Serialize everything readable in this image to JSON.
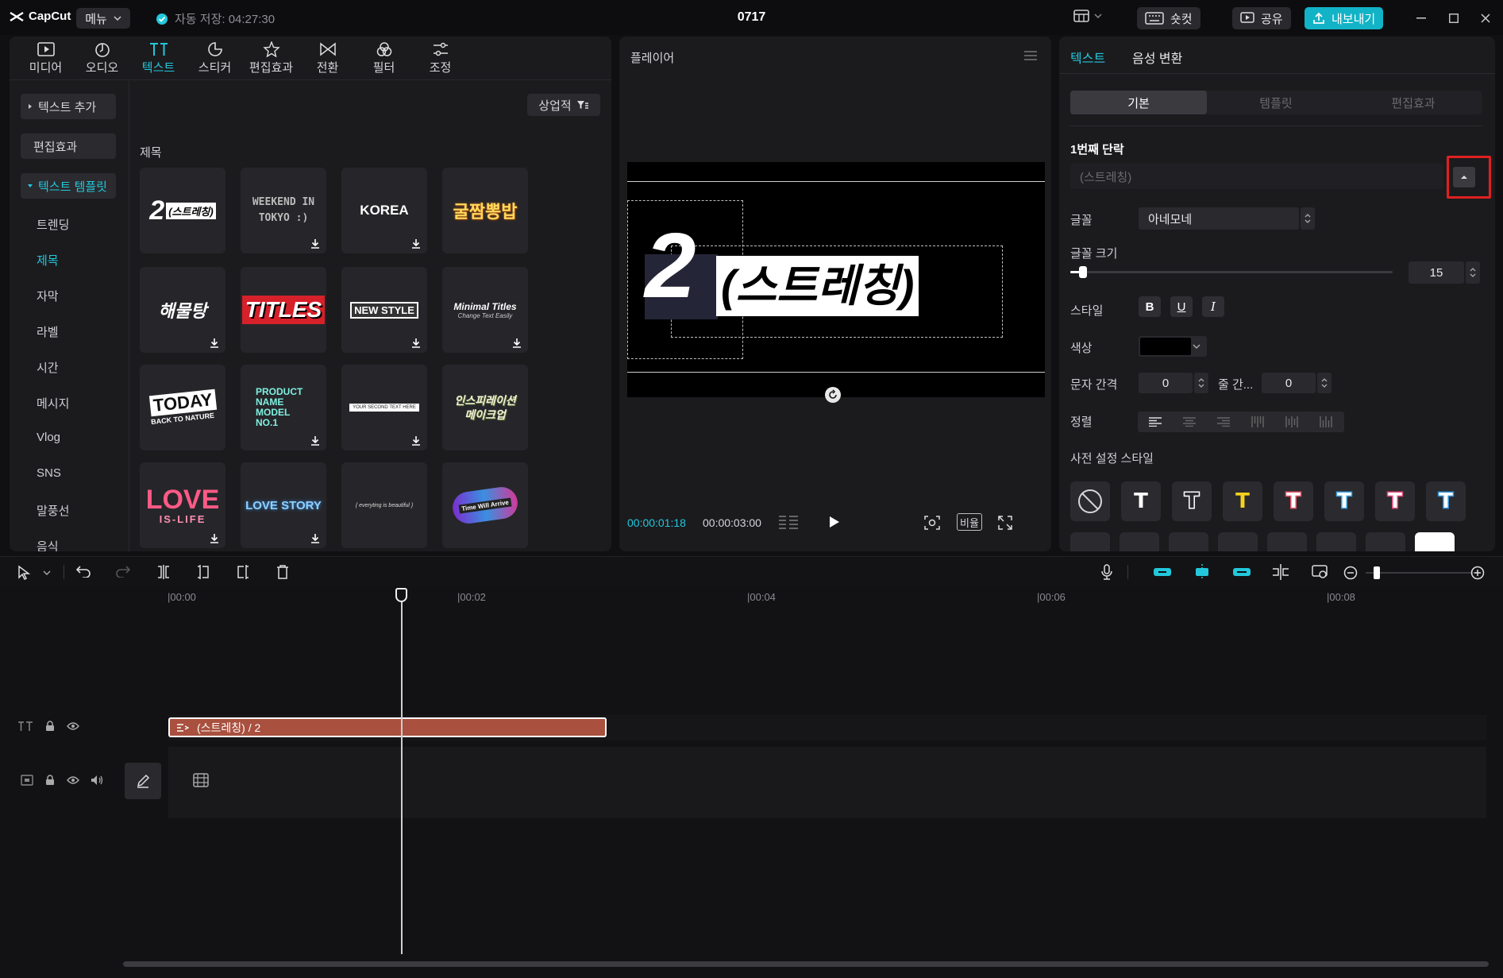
{
  "app": {
    "logo_text": "CapCut",
    "menu_label": "메뉴",
    "autosave": "자동 저장: 04:27:30",
    "project_title": "0717"
  },
  "titlebar_buttons": {
    "shortcut": "숏컷",
    "share": "공유",
    "export": "내보내기"
  },
  "tool_tabs": [
    {
      "label": "미디어",
      "icon": "media-icon",
      "active": false
    },
    {
      "label": "오디오",
      "icon": "audio-icon",
      "active": false
    },
    {
      "label": "텍스트",
      "icon": "text-icon",
      "active": true
    },
    {
      "label": "스티커",
      "icon": "sticker-icon",
      "active": false
    },
    {
      "label": "편집효과",
      "icon": "effects-icon",
      "active": false
    },
    {
      "label": "전환",
      "icon": "transition-icon",
      "active": false
    },
    {
      "label": "필터",
      "icon": "filter-icon",
      "active": false
    },
    {
      "label": "조정",
      "icon": "adjust-icon",
      "active": false
    }
  ],
  "left_nav": {
    "add_text": "텍스트 추가",
    "effects": "편집효과",
    "templates": "텍스트 템플릿",
    "items": [
      "트렌딩",
      "제목",
      "자막",
      "라벨",
      "시간",
      "메시지",
      "Vlog",
      "SNS",
      "말풍선",
      "음식"
    ],
    "active_item": "제목"
  },
  "library": {
    "sort_label": "상업적",
    "section_title": "제목",
    "thumbnails": [
      {
        "text": "2(스트레칭)",
        "download": false
      },
      {
        "text": "WEEKEND IN TOKYO :)",
        "download": true
      },
      {
        "text": "KOREA",
        "download": true
      },
      {
        "text": "굴짬뽕밥",
        "download": false
      },
      {
        "text": "해물탕",
        "download": true
      },
      {
        "text": "TITLES",
        "download": false
      },
      {
        "text": "NEW STYLE",
        "download": true
      },
      {
        "text": "Minimal Titles",
        "sub": "Change Text Easily",
        "download": true
      },
      {
        "text": "TODAY",
        "sub": "BACK TO NATURE",
        "download": false
      },
      {
        "text": "PRODUCT NAME MODEL NO.1",
        "download": true
      },
      {
        "text": "YOUR SECOND TEXT HERE",
        "download": true
      },
      {
        "text": "인스피레이션 메이크업",
        "download": false
      },
      {
        "text": "LOVE",
        "sub": "IS-LIFE",
        "download": true
      },
      {
        "text": "LOVE STORY",
        "download": true
      },
      {
        "text": "{ everyting is beautiful }",
        "download": false
      },
      {
        "text": "Time Will Arrive",
        "download": false
      }
    ]
  },
  "player": {
    "title": "플레이어",
    "canvas_big": "2",
    "canvas_text": "(스트레칭)",
    "time_current": "00:00:01:18",
    "time_total": "00:00:03:00",
    "ratio_label": "비율"
  },
  "inspector": {
    "tabs": [
      {
        "label": "텍스트",
        "active": true
      },
      {
        "label": "음성 변환",
        "active": false
      }
    ],
    "segments": [
      {
        "label": "기본",
        "active": true
      },
      {
        "label": "템플릿",
        "active": false
      },
      {
        "label": "편집효과",
        "active": false
      }
    ],
    "paragraph_label": "1번째 단락",
    "paragraph_value": "(스트레칭)",
    "font_label": "글꼴",
    "font_value": "아네모네",
    "size_label": "글꼴 크기",
    "size_value": "15",
    "size_fraction": 0.04,
    "style_label": "스타일",
    "style_buttons": [
      "B",
      "U",
      "I"
    ],
    "color_label": "색상",
    "spacing_label": "문자 간격",
    "spacing_value": "0",
    "line_spacing_label": "줄 간...",
    "line_spacing_value": "0",
    "align_label": "정렬",
    "preset_label": "사전 설정 스타일",
    "presets": [
      {
        "glyph": "⊘",
        "color": "#d6d6da",
        "stroke": "none"
      },
      {
        "glyph": "T",
        "color": "#ffffff",
        "stroke": "none"
      },
      {
        "glyph": "T",
        "color": "#2b2b2f",
        "stroke": "#ffffff"
      },
      {
        "glyph": "T",
        "color": "#f6d21c",
        "stroke": "none"
      },
      {
        "glyph": "T",
        "color": "#ffffff",
        "stroke": "#e8546a"
      },
      {
        "glyph": "T",
        "color": "#ffffff",
        "stroke": "#3aa0e0"
      },
      {
        "glyph": "T",
        "color": "#ffffff",
        "stroke": "#e8467a"
      },
      {
        "glyph": "T",
        "color": "#ffffff",
        "stroke": "#2c8fd8"
      }
    ]
  },
  "timeline": {
    "ruler": [
      "|00:00",
      "|00:02",
      "|00:04",
      "|00:06",
      "|00:08"
    ],
    "text_clip": "(스트레칭)  / 2"
  },
  "colors": {
    "accent": "#22c8dc",
    "clip": "#a9503f",
    "panel": "#1b1b1e",
    "highlight": "#e02020"
  }
}
